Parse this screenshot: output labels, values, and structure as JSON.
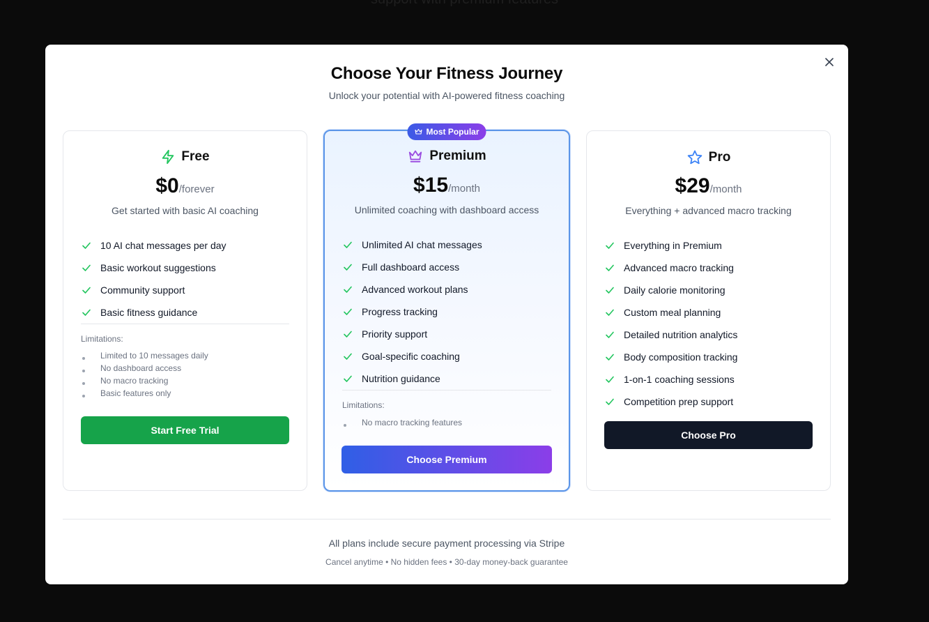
{
  "backdrop": {
    "text": "support with premium features"
  },
  "modal": {
    "title": "Choose Your Fitness Journey",
    "subtitle": "Unlock your potential with AI-powered fitness coaching",
    "close_icon": "close-icon"
  },
  "colors": {
    "check": "#22c55e",
    "free_accent": "#16a34a",
    "premium_accent": "#8b3ee8",
    "pro_accent": "#3b82f6",
    "premium_border": "#5b95e8",
    "dark_button": "#111827"
  },
  "plans": [
    {
      "name": "Free",
      "icon": "lightning-icon",
      "price": "$0",
      "period": "/forever",
      "description": "Get started with basic AI coaching",
      "features": [
        "10 AI chat messages per day",
        "Basic workout suggestions",
        "Community support",
        "Basic fitness guidance"
      ],
      "limitations_title": "Limitations:",
      "limitations": [
        "Limited to 10 messages daily",
        "No dashboard access",
        "No macro tracking",
        "Basic features only"
      ],
      "button": "Start Free Trial"
    },
    {
      "name": "Premium",
      "icon": "crown-icon",
      "badge": "Most Popular",
      "badge_icon": "crown-icon",
      "price": "$15",
      "period": "/month",
      "description": "Unlimited coaching with dashboard access",
      "features": [
        "Unlimited AI chat messages",
        "Full dashboard access",
        "Advanced workout plans",
        "Progress tracking",
        "Priority support",
        "Goal-specific coaching",
        "Nutrition guidance"
      ],
      "limitations_title": "Limitations:",
      "limitations": [
        "No macro tracking features"
      ],
      "button": "Choose Premium"
    },
    {
      "name": "Pro",
      "icon": "star-icon",
      "price": "$29",
      "period": "/month",
      "description": "Everything + advanced macro tracking",
      "features": [
        "Everything in Premium",
        "Advanced macro tracking",
        "Daily calorie monitoring",
        "Custom meal planning",
        "Detailed nutrition analytics",
        "Body composition tracking",
        "1-on-1 coaching sessions",
        "Competition prep support"
      ],
      "button": "Choose Pro"
    }
  ],
  "footer": {
    "main": "All plans include secure payment processing via Stripe",
    "sub": "Cancel anytime • No hidden fees • 30-day money-back guarantee"
  }
}
